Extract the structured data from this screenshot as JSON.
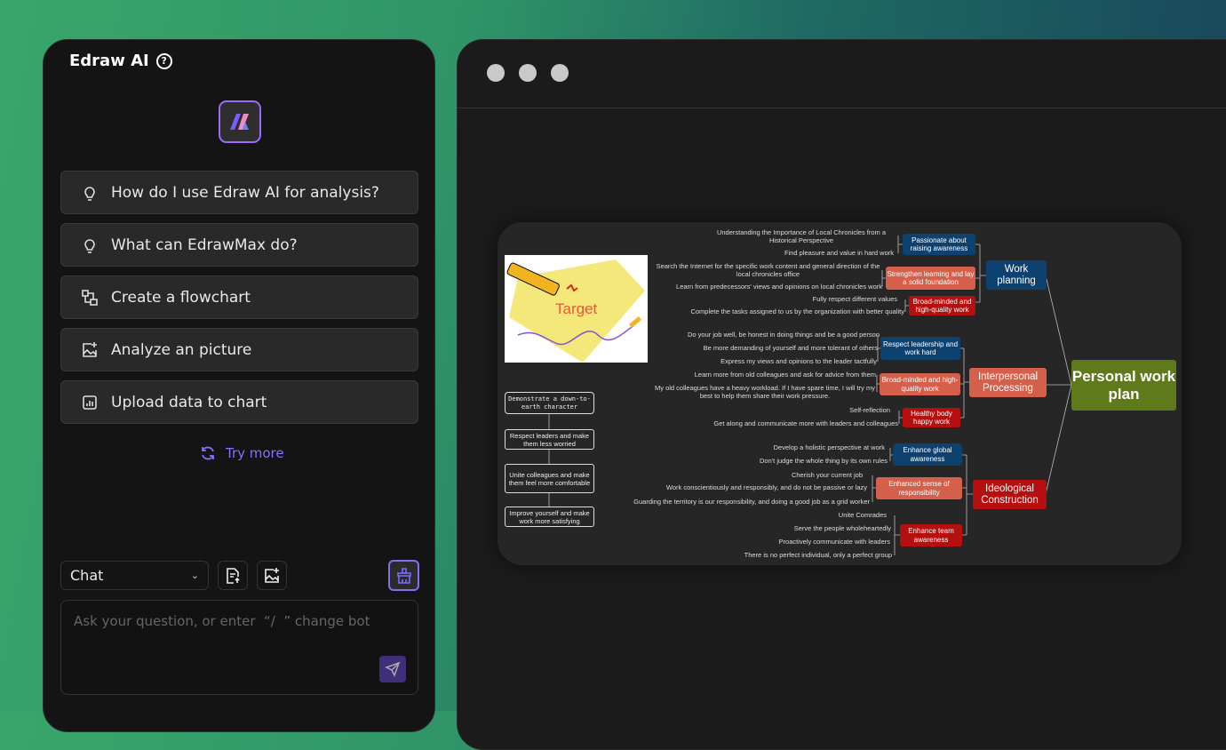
{
  "sidebar": {
    "title": "Edraw AI",
    "suggestions": [
      {
        "label": "How do I use Edraw AI for analysis?",
        "icon": "lightbulb-icon"
      },
      {
        "label": "What can EdrawMax do?",
        "icon": "lightbulb-icon"
      },
      {
        "label": "Create a flowchart",
        "icon": "flowchart-icon"
      },
      {
        "label": "Analyze an picture",
        "icon": "image-analyze-icon"
      },
      {
        "label": "Upload data to chart",
        "icon": "chart-upload-icon"
      }
    ],
    "try_more": "Try more",
    "mode_select": "Chat",
    "input_placeholder": "Ask your question, or enter  “/  ” change bot",
    "accent": "#8b6dff"
  },
  "mindmap": {
    "root": "Personal work plan",
    "image_text": "Target",
    "branches": [
      {
        "label": "Work planning",
        "groups": [
          {
            "label": "Passionate about raising awareness",
            "leaves": [
              "Understanding the Importance of Local Chronicles from a Historical Perspective",
              "Find pleasure and value in hard work"
            ]
          },
          {
            "label": "Strengthen learning and lay a solid foundation",
            "leaves": [
              "Search the Internet for the specific work content and general direction of the local chronicles office",
              "Learn from predecessors' views and opinions on local chronicles work"
            ]
          },
          {
            "label": "Broad-minded and high-quality work",
            "leaves": [
              "Fully respect different values",
              "Complete the tasks assigned to us by the organization with better quality"
            ]
          }
        ]
      },
      {
        "label": "Interpersonal Processing",
        "groups": [
          {
            "label": "Respect leadership and work hard",
            "leaves": [
              "Do your job well, be honest in doing things and be a good person",
              "Be more demanding of yourself and more tolerant of others",
              "Express my views and opinions to the leader tactfully"
            ]
          },
          {
            "label": "Broad-minded and high-quality work",
            "leaves": [
              "Learn more from old colleagues and ask for advice from them",
              "My old colleagues have a heavy workload. If I have spare time, I will try my best to help them share their work pressure."
            ]
          },
          {
            "label": "Healthy body happy work",
            "leaves": [
              "Self-reflection",
              "Get along and communicate more with leaders and colleagues"
            ]
          }
        ]
      },
      {
        "label": "Ideological Construction",
        "groups": [
          {
            "label": "Enhance global awareness",
            "leaves": [
              "Develop a holistic perspective at work",
              "Don't judge the whole thing by its own rules"
            ]
          },
          {
            "label": "Enhanced sense of responsibility",
            "leaves": [
              "Cherish your current job",
              "Work conscientiously and responsibly, and do not be passive or lazy",
              "Guarding the territory is our responsibility, and doing a good job as a grid worker"
            ]
          },
          {
            "label": "Enhance team awareness",
            "leaves": [
              "Unite Comrades",
              "Serve the people wholeheartedly",
              "Proactively communicate with leaders",
              "There is no perfect individual, only a perfect group"
            ]
          }
        ]
      }
    ],
    "flow": [
      "Demonstrate a down-to-earth character",
      "Respect leaders and make them less worried",
      "Unite colleagues and make them feel more comfortable",
      "Improve yourself and make work more satisfying"
    ],
    "colors": {
      "root": "#5f7a1a",
      "blue": "#0d4170",
      "salmon": "#d4604b",
      "red": "#b50f0f"
    }
  }
}
